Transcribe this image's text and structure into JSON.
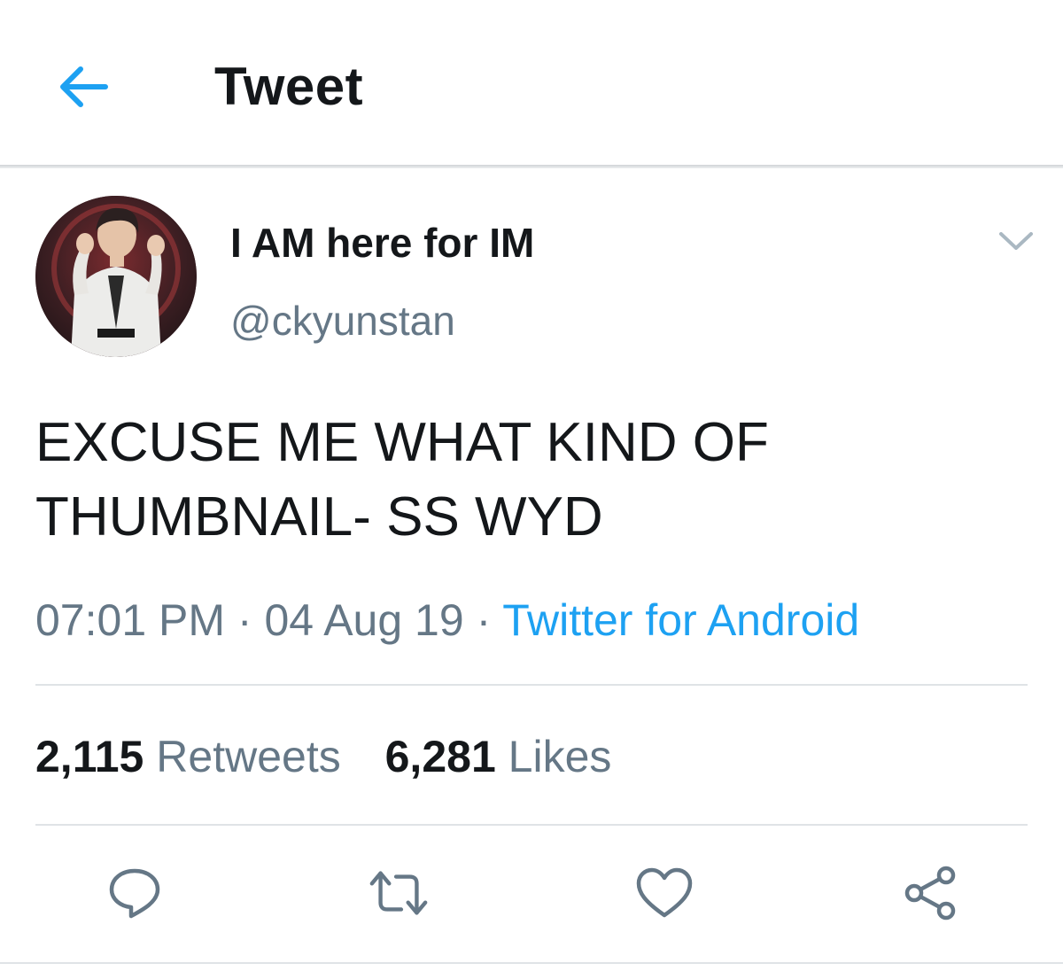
{
  "header": {
    "title": "Tweet",
    "back_icon": "arrow-left-icon",
    "accent_color": "#1da1f2"
  },
  "tweet": {
    "display_name": "I AM here for IM",
    "handle": "@ckyunstan",
    "text_line1": "EXCUSE ME WHAT KIND OF",
    "text_line2": "THUMBNAIL- SS WYD",
    "time": "07:01 PM",
    "date": "04 Aug 19",
    "separator": " · ",
    "source": "Twitter for Android",
    "retweets_count": "2,115",
    "retweets_label": "Retweets",
    "likes_count": "6,281",
    "likes_label": "Likes"
  },
  "actions": [
    "reply-icon",
    "retweet-icon",
    "like-icon",
    "share-icon"
  ],
  "colors": {
    "text": "#14171a",
    "secondary": "#657786",
    "link": "#1da1f2",
    "divider": "#dfe3e6"
  }
}
